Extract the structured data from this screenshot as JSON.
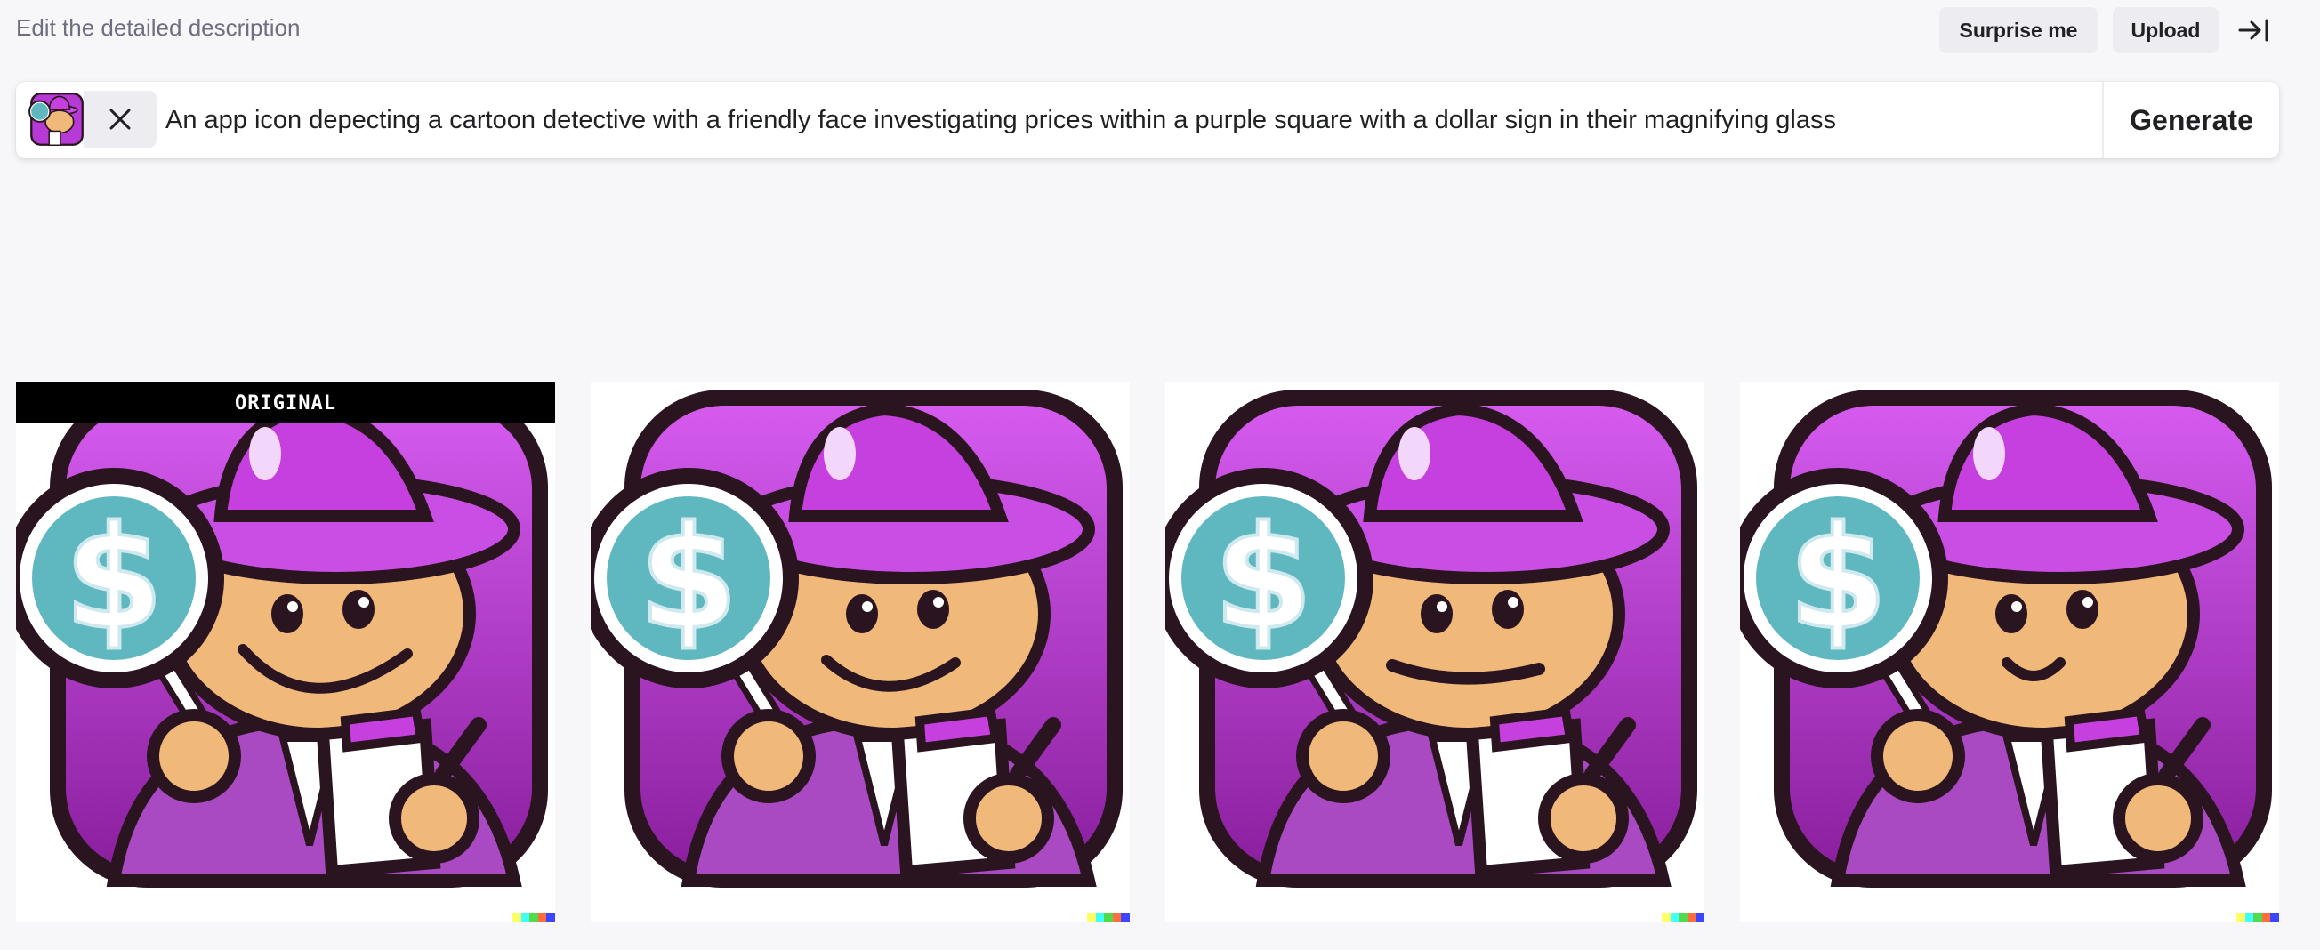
{
  "header": {
    "hint": "Edit the detailed description",
    "surprise_label": "Surprise me",
    "upload_label": "Upload",
    "collapse_icon": "collapse-right-icon"
  },
  "prompt": {
    "text": "An app icon depecting a cartoon detective with a friendly face investigating prices within a purple square with a dollar sign in their magnifying glass",
    "generate_label": "Generate",
    "clear_icon": "close-icon"
  },
  "results": {
    "original_label": "ORIGINAL",
    "images": [
      {
        "label": "ORIGINAL",
        "expression": "big-smile"
      },
      {
        "label": "",
        "expression": "smile"
      },
      {
        "label": "",
        "expression": "smirk"
      },
      {
        "label": "",
        "expression": "small-smile"
      }
    ],
    "signature_colors": [
      "#ffff66",
      "#42ffff",
      "#51da4c",
      "#ff6e3c",
      "#3c46ff"
    ]
  },
  "colors": {
    "background": "#f7f7f9",
    "button_bg": "#ececf1",
    "icon_purple": "#b73ad6",
    "icon_outline": "#2a1420",
    "lens_teal": "#5fb8c0",
    "skin": "#f0b97a"
  }
}
